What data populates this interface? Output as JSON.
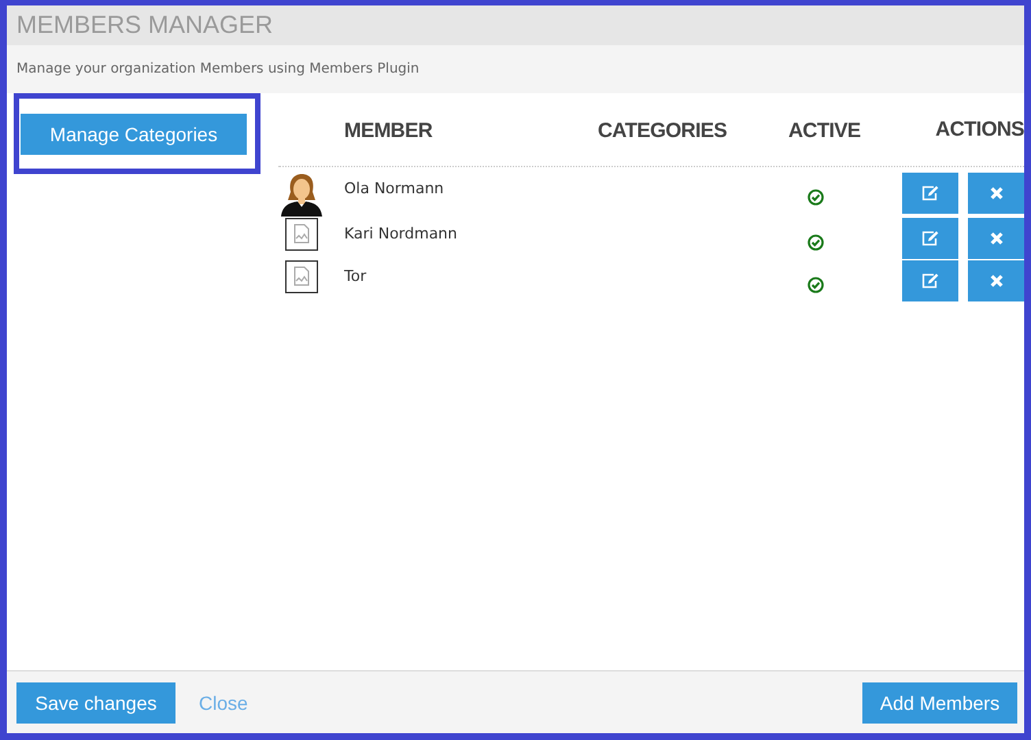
{
  "window": {
    "title": "MEMBERS MANAGER",
    "subtitle": "Manage your organization Members using Members Plugin"
  },
  "sidebar": {
    "button": "Manage Categories",
    "highlighted": true
  },
  "table": {
    "columns": [
      "MEMBER",
      "CATEGORIES",
      "ACTIVE",
      "ACTIONS"
    ],
    "rows": [
      {
        "avatar": {
          "kind": "person"
        },
        "name": "Ola Normann",
        "active": true
      },
      {
        "avatar": {
          "kind": "broken"
        },
        "name": "Kari Nordmann",
        "active": true
      },
      {
        "avatar": {
          "kind": "broken"
        },
        "name": "Tor",
        "active": true
      }
    ]
  },
  "footer": {
    "save": "Save changes",
    "close": "Close",
    "add": "Add Members"
  }
}
